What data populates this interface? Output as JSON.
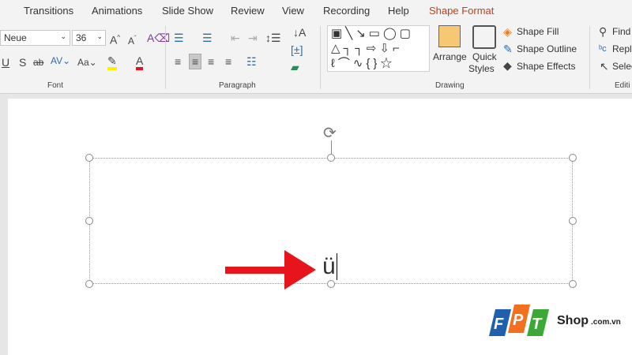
{
  "tabs": [
    "Transitions",
    "Animations",
    "Slide Show",
    "Review",
    "View",
    "Recording",
    "Help",
    "Shape Format"
  ],
  "font": {
    "name": "Neue",
    "size": "36",
    "group": "Font"
  },
  "paragraph": {
    "group": "Paragraph"
  },
  "drawing": {
    "group": "Drawing",
    "arrange": "Arrange",
    "quick": "Quick",
    "styles": "Styles",
    "fill": "Shape Fill",
    "outline": "Shape Outline",
    "effects": "Shape Effects"
  },
  "editing": {
    "find": "Find",
    "replace": "Repla",
    "select": "Selec",
    "group": "Editi"
  },
  "slide": {
    "text": "ü"
  },
  "logo": {
    "brand": "FPT",
    "shop": "Shop",
    "domain": ".com.vn"
  },
  "colors": {
    "accent": "#c43e1c",
    "arrow": "#e8141b"
  }
}
